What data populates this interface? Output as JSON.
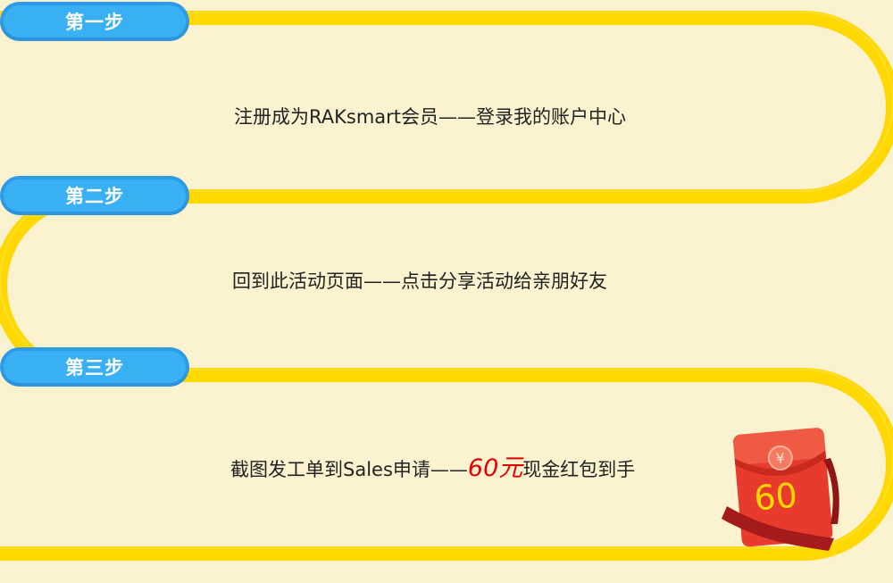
{
  "steps": [
    {
      "label": "第一步",
      "text": "注册成为RAKsmart会员——登录我的账户中心"
    },
    {
      "label": "第二步",
      "text": "回到此活动页面——点击分享活动给亲朋好友"
    },
    {
      "label": "第三步",
      "text_before": "截图发工单到Sales申请——",
      "highlight": "60元",
      "text_after": "现金红包到手"
    }
  ],
  "red_packet": {
    "amount": "60",
    "symbol": "¥"
  },
  "colors": {
    "background": "#fbf2cf",
    "track": "#ffd800",
    "badge": "#39b0f4",
    "highlight": "#e40000",
    "packet_red": "#e93b2d"
  }
}
